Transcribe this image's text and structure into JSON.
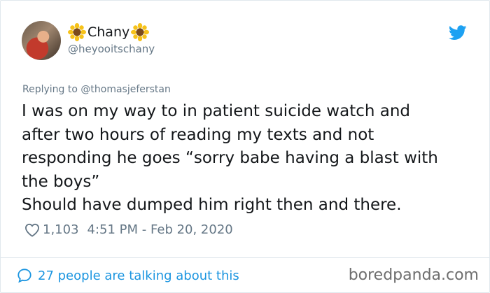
{
  "user": {
    "display_name": "Chany",
    "handle": "@heyooitschany",
    "name_emoji": "sunflower-icon"
  },
  "reply": {
    "prefix": "Replying to ",
    "mention": "@thomasjeferstan"
  },
  "tweet": {
    "text": "I was on my way to in patient suicide watch and\nafter two hours of reading my texts and not\nresponding he goes “sorry babe having a blast with\nthe boys”\nShould have dumped him right then and there."
  },
  "meta": {
    "likes": "1,103",
    "time": "4:51 PM - Feb 20, 2020"
  },
  "footer": {
    "talking": "27 people are talking about this",
    "watermark": "boredpanda.com"
  },
  "colors": {
    "link": "#1b95e0",
    "muted": "#657786",
    "twitter_blue": "#1da1f2"
  }
}
